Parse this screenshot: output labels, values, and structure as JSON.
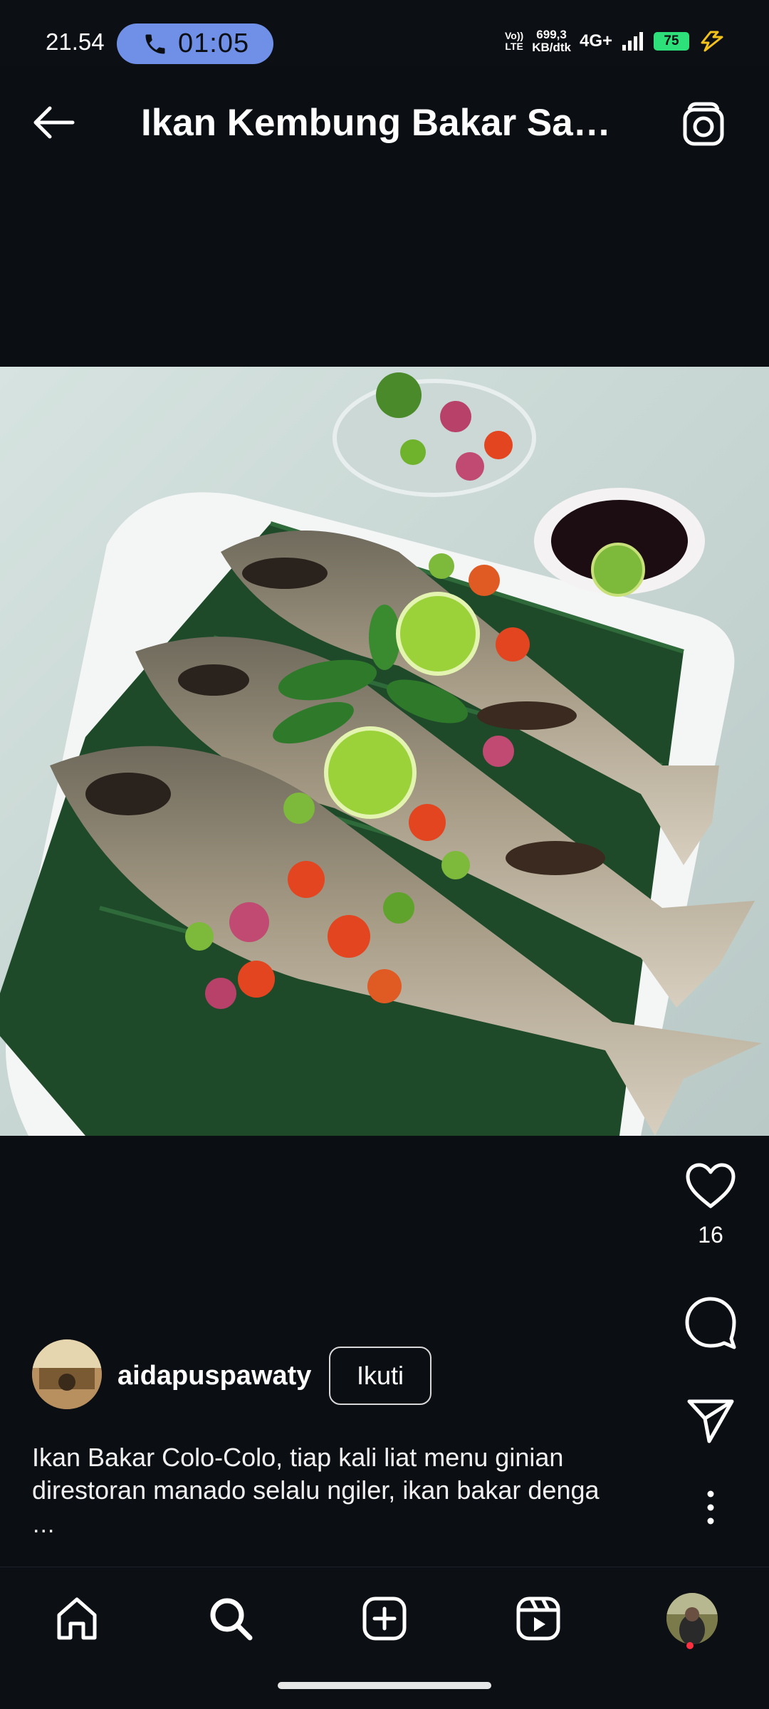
{
  "status_bar": {
    "time": "21.54",
    "call_timer": "01:05",
    "volte_line1": "Vo))",
    "volte_line2": "LTE",
    "speed_line1": "699,3",
    "speed_line2": "KB/dtk",
    "network": "4G+",
    "battery": "75"
  },
  "header": {
    "title": "Ikan Kembung Bakar Sam…"
  },
  "post": {
    "like_count": "16",
    "author": {
      "username": "aidapuspawaty",
      "follow_label": "Ikuti"
    },
    "caption_line1": "Ikan Bakar Colo-Colo, tiap kali liat menu ginian",
    "caption_line2": "direstoran manado selalu ngiler, ikan bakar denga",
    "caption_more": "..."
  },
  "icons": {
    "back": "arrow-left-icon",
    "camera": "camera-icon",
    "like": "heart-icon",
    "comment": "comment-icon",
    "share": "send-icon",
    "more": "more-vertical-icon",
    "nav": [
      "home-icon",
      "search-icon",
      "add-post-icon",
      "reels-icon",
      "profile-avatar"
    ]
  },
  "colors": {
    "background": "#0b0e13",
    "call_pill": "#6f90e6",
    "battery": "#2ee07a",
    "notification_dot": "#ff3040"
  }
}
